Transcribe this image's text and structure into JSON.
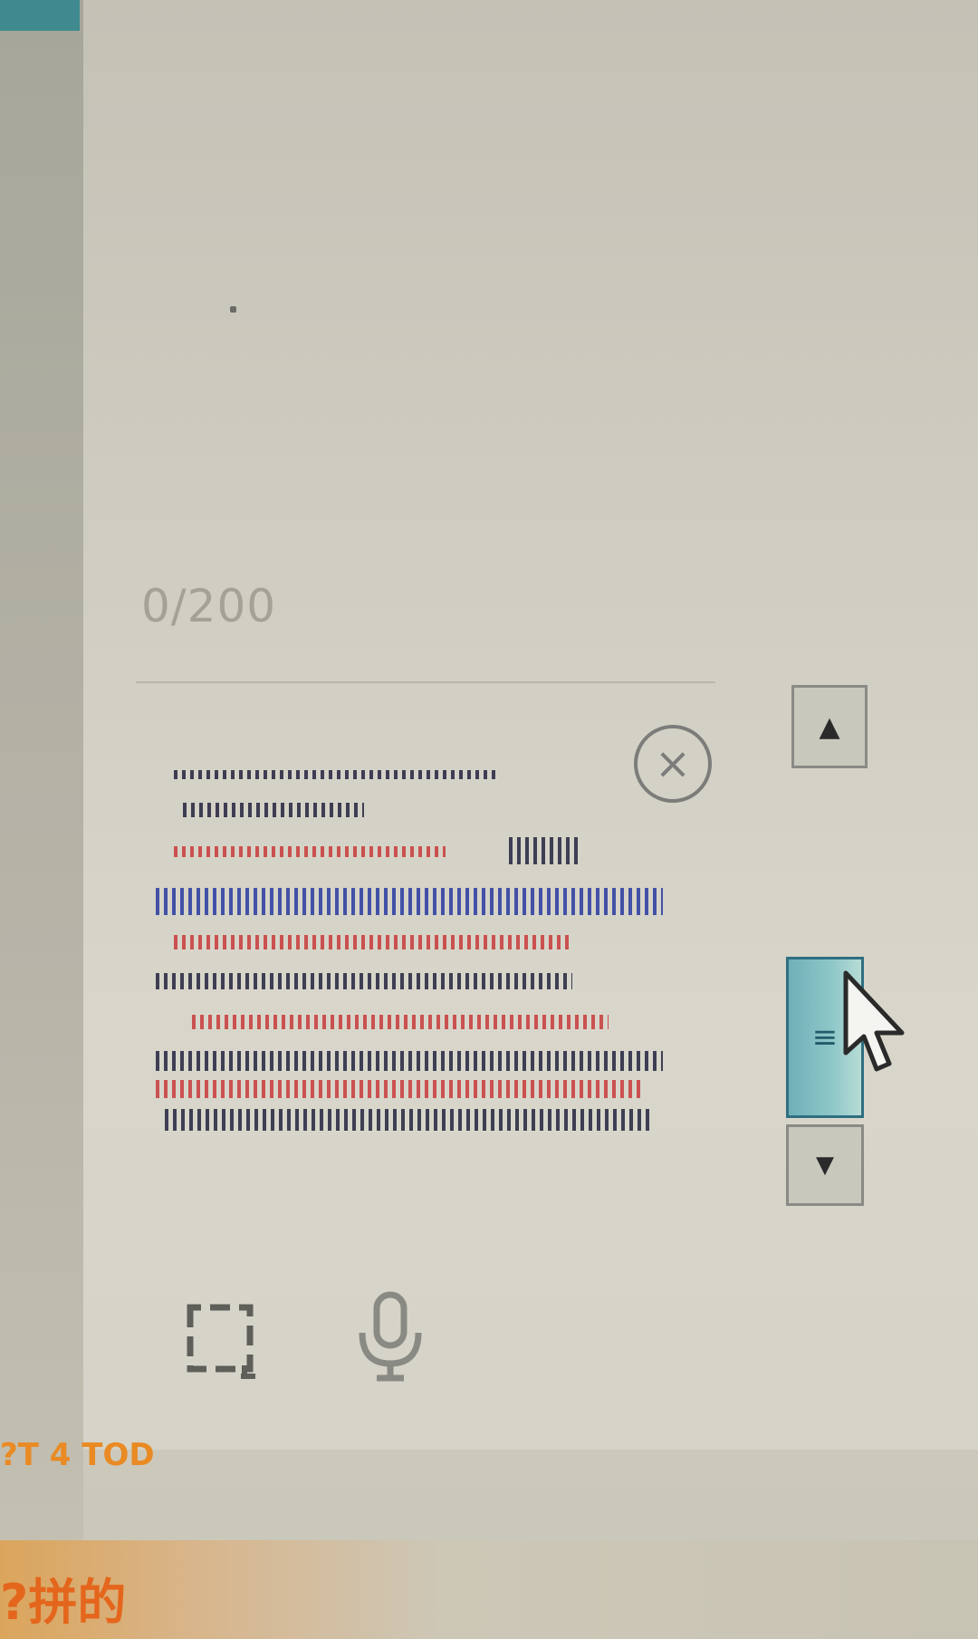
{
  "input": {
    "char_counter": "0/200"
  },
  "buttons": {
    "clear_icon": "×",
    "scroll_up_icon": "▲",
    "scroll_down_icon": "▼",
    "scroll_thumb_grip": "≡"
  },
  "toolbar": {
    "screenshot_icon": "crop-frame",
    "voice_icon": "microphone"
  },
  "footer": {
    "meta_left": "?T 4 TOD",
    "meta_right": "",
    "action_label": "?拼的"
  },
  "colors": {
    "accent": "#e98a24",
    "scroll_thumb": "#6fb0b8",
    "quote_red": "#c83a3a",
    "quote_blue": "#283aa0"
  }
}
